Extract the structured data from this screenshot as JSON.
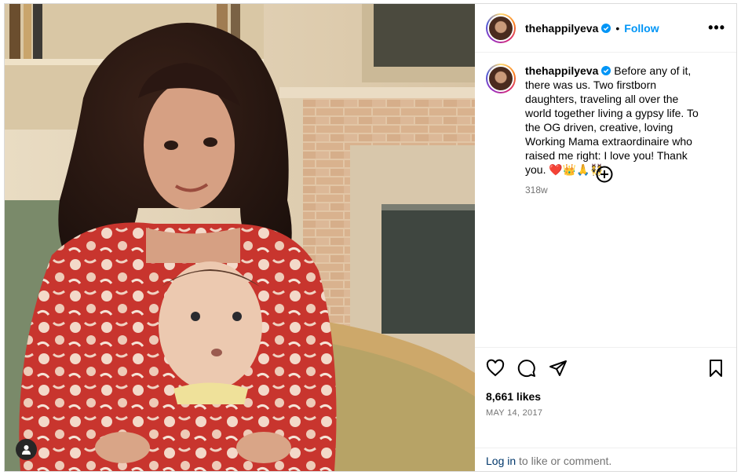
{
  "post": {
    "username": "thehappilyeva",
    "follow_label": "Follow",
    "separator": "•",
    "more_label": "•••",
    "caption": "Before any of it, there was us. Two firstborn daughters, traveling all over the world together living a gypsy life. To the OG driven, creative, loving Working Mama extraordinaire who raised me right: I love you! Thank you. ❤️👑🙏👯",
    "caption_time": "318w",
    "likes": "8,661 likes",
    "date": "MAY 14, 2017",
    "login_link": "Log in",
    "login_rest": " to like or comment."
  },
  "icons": {
    "like": "heart-icon",
    "comment": "comment-icon",
    "share": "share-icon",
    "save": "bookmark-icon",
    "add": "plus-circle-icon",
    "tag": "user-tag-icon",
    "verified": "verified-badge-icon"
  },
  "colors": {
    "accent": "#0095f6",
    "verified": "#0095f6",
    "muted": "#737373"
  }
}
